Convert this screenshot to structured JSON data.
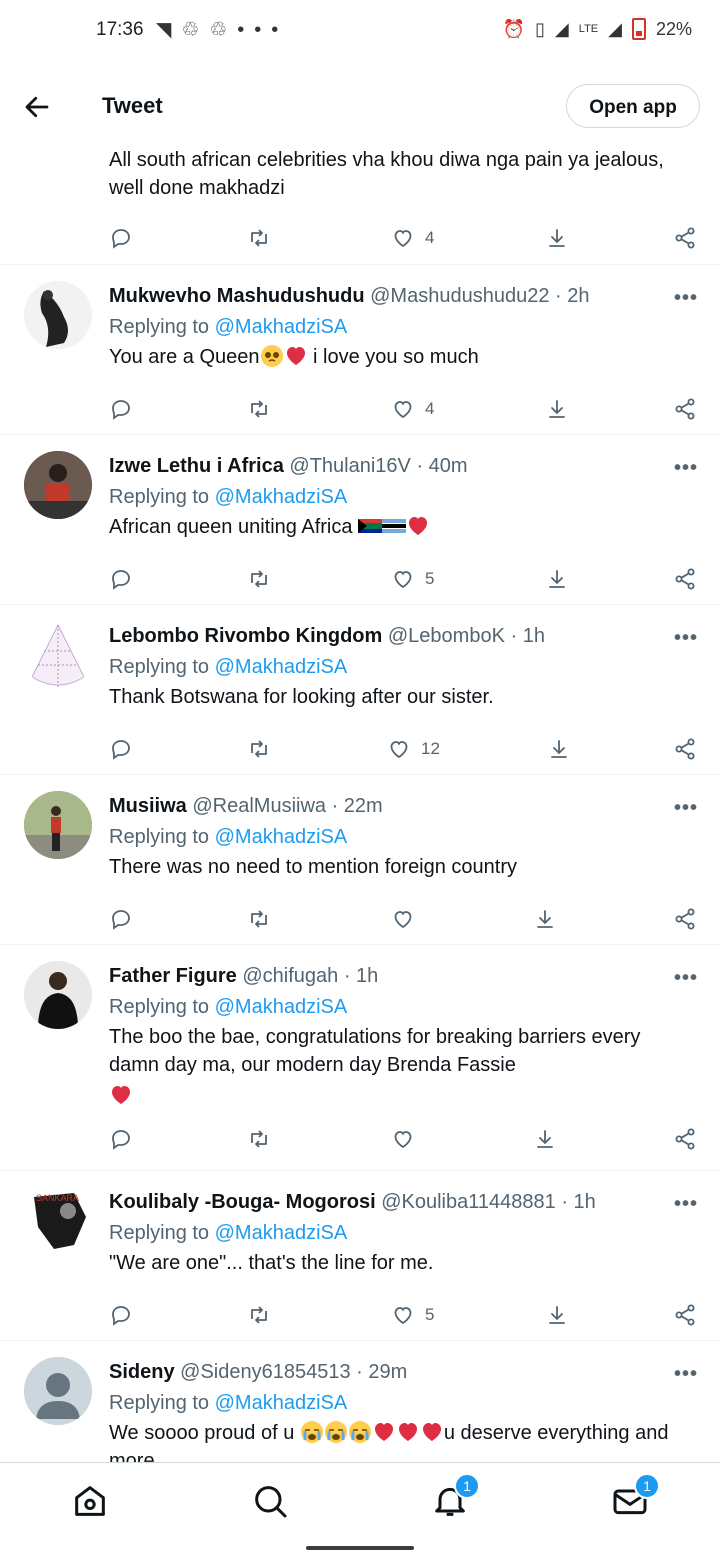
{
  "status_bar": {
    "time": "17:36",
    "network": "LTE",
    "battery": "22%"
  },
  "header": {
    "title": "Tweet",
    "open_app": "Open app"
  },
  "first_tweet": {
    "text": "All south african celebrities vha khou diwa nga pain ya jealous, well done makhadzi",
    "likes": "4"
  },
  "replying_label": "Replying to",
  "tweets": [
    {
      "name": "Mukwevho Mashudushudu",
      "handle": "@Mashudushudu22",
      "time": "· 2h",
      "replying_to": "@MakhadziSA",
      "text": "You are a Queen",
      "text_after": " i love you so much",
      "likes": "4"
    },
    {
      "name": "Izwe Lethu i Africa",
      "handle": "@Thulani16V",
      "time": "· 40m",
      "replying_to": "@MakhadziSA",
      "text": "African queen uniting Africa ",
      "text_after": "",
      "likes": "5"
    },
    {
      "name": "Lebombo Rivombo Kingdom",
      "handle": "@LebomboK",
      "time": "· 1h",
      "replying_to": "@MakhadziSA",
      "text": "Thank Botswana for looking after our sister.",
      "text_after": "",
      "likes": "12"
    },
    {
      "name": "Musiiwa",
      "handle": "@RealMusiiwa",
      "time": "· 22m",
      "replying_to": "@MakhadziSA",
      "text": "There was no need to mention foreign country",
      "text_after": "",
      "likes": ""
    },
    {
      "name": "Father Figure",
      "handle": "@chifugah",
      "time": "· 1h",
      "replying_to": "@MakhadziSA",
      "text": "The boo the bae, congratulations for breaking barriers every damn day ma, our modern day Brenda Fassie",
      "text_after": "",
      "likes": ""
    },
    {
      "name": "Koulibaly -Bouga- Mogorosi",
      "handle": "@Kouliba11448881",
      "time": "· 1h",
      "replying_to": "@MakhadziSA",
      "text": "\"We are one\"... that's the line for me.",
      "text_after": "",
      "likes": "5"
    },
    {
      "name": "Sideny",
      "handle": "@Sideny61854513",
      "time": "· 29m",
      "replying_to": "@MakhadziSA",
      "text": "We soooo proud of u ",
      "text_after": "u deserve everything and more",
      "likes": ""
    }
  ],
  "avatar_4_text": "SANKARA",
  "nav": {
    "notifications_badge": "1",
    "messages_badge": "1"
  },
  "icons": [
    "back-arrow-icon",
    "reply-icon",
    "retweet-icon",
    "heart-icon",
    "share-icon",
    "more-icon",
    "home-icon",
    "search-icon",
    "bell-icon",
    "mail-icon"
  ],
  "colors": {
    "accent": "#1d9bf0",
    "text": "#0f1419",
    "muted": "#536471",
    "heart_red": "#e0245e"
  }
}
